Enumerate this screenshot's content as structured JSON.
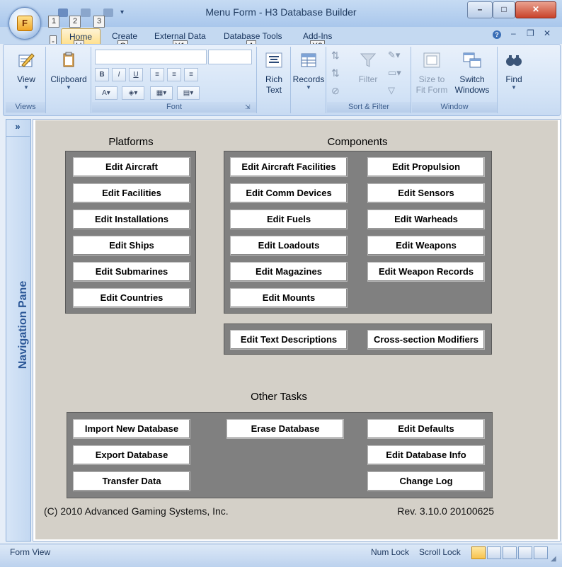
{
  "window": {
    "title": "Menu Form - H3 Database Builder",
    "office_button_letter": "F",
    "qat_keytips": [
      "1",
      "2",
      "3"
    ],
    "controls": {
      "minimize": "–",
      "maximize": "□",
      "close": "✕"
    }
  },
  "ribbon": {
    "tabs": [
      {
        "label": "Home",
        "keytip": "H"
      },
      {
        "label": "Create",
        "keytip": "C"
      },
      {
        "label": "External Data",
        "keytip": "X1"
      },
      {
        "label": "Database Tools",
        "keytip": "A"
      },
      {
        "label": "Add-Ins",
        "keytip": "X2"
      }
    ],
    "minus_keytip": "-",
    "mdi_controls": {
      "help": "?",
      "minimize": "–",
      "restore": "❐",
      "close": "✕"
    },
    "groups": {
      "views": {
        "label": "Views",
        "view_button": "View"
      },
      "clipboard": {
        "label": "Clipboard",
        "button": "Clipboard"
      },
      "font": {
        "label": "Font",
        "bold": "B",
        "italic": "I",
        "underline": "U"
      },
      "rich_text": {
        "label": "Rich Text"
      },
      "records": {
        "label": "Records"
      },
      "sort_filter": {
        "label": "Sort & Filter",
        "filter": "Filter"
      },
      "window": {
        "label": "Window",
        "size_to_fit": "Size to Fit Form",
        "switch_windows": "Switch Windows"
      },
      "find": {
        "label": "Find"
      }
    }
  },
  "nav_pane": {
    "toggle": "»",
    "label": "Navigation Pane"
  },
  "form": {
    "platforms": {
      "heading": "Platforms",
      "buttons": [
        "Edit Aircraft",
        "Edit Facilities",
        "Edit Installations",
        "Edit Ships",
        "Edit Submarines",
        "Edit Countries"
      ]
    },
    "components": {
      "heading": "Components",
      "left_buttons": [
        "Edit Aircraft Facilities",
        "Edit Comm Devices",
        "Edit Fuels",
        "Edit Loadouts",
        "Edit Magazines",
        "Edit Mounts"
      ],
      "right_buttons": [
        "Edit Propulsion",
        "Edit Sensors",
        "Edit Warheads",
        "Edit Weapons",
        "Edit Weapon Records"
      ],
      "extra_buttons": [
        "Edit Text Descriptions",
        "Cross-section Modifiers"
      ]
    },
    "other_tasks": {
      "heading": "Other Tasks",
      "buttons": [
        "Import New Database",
        "Export Database",
        "Transfer Data",
        "Erase Database",
        "Edit Defaults",
        "Edit Database Info",
        "Change Log"
      ]
    },
    "copyright": "(C) 2010 Advanced Gaming Systems, Inc.",
    "revision": "Rev. 3.10.0 20100625"
  },
  "status_bar": {
    "view": "Form View",
    "num_lock": "Num Lock",
    "scroll_lock": "Scroll Lock"
  }
}
